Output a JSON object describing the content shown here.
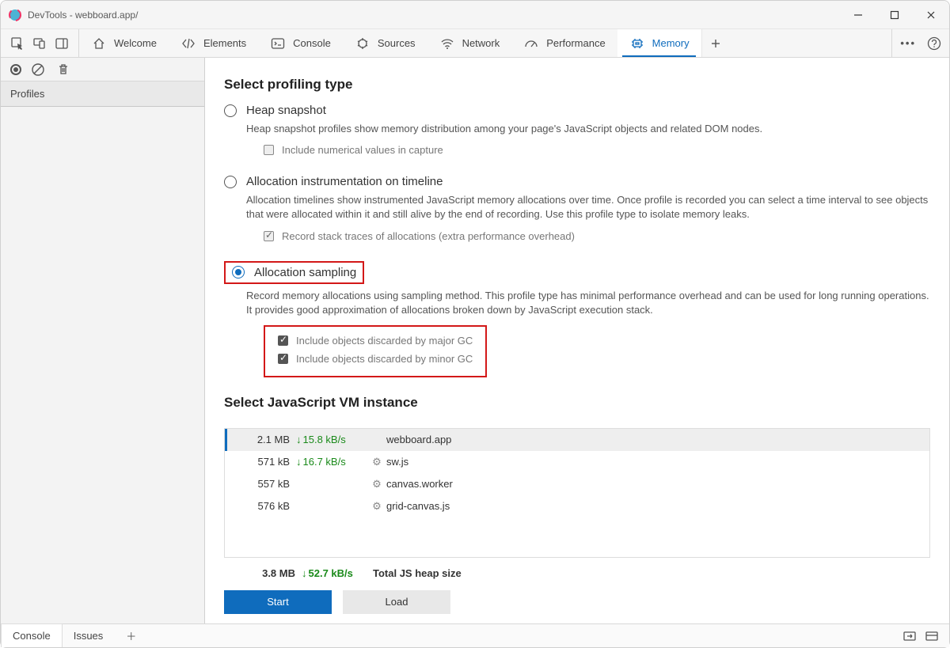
{
  "window": {
    "title": "DevTools - webboard.app/"
  },
  "tabs": [
    {
      "label": "Welcome"
    },
    {
      "label": "Elements"
    },
    {
      "label": "Console"
    },
    {
      "label": "Sources"
    },
    {
      "label": "Network"
    },
    {
      "label": "Performance"
    },
    {
      "label": "Memory"
    }
  ],
  "sidebar": {
    "section": "Profiles"
  },
  "memory": {
    "heading_type": "Select profiling type",
    "heap": {
      "title": "Heap snapshot",
      "desc": "Heap snapshot profiles show memory distribution among your page's JavaScript objects and related DOM nodes.",
      "opt_numeric": "Include numerical values in capture"
    },
    "timeline": {
      "title": "Allocation instrumentation on timeline",
      "desc": "Allocation timelines show instrumented JavaScript memory allocations over time. Once profile is recorded you can select a time interval to see objects that were allocated within it and still alive by the end of recording. Use this profile type to isolate memory leaks.",
      "opt_stack": "Record stack traces of allocations (extra performance overhead)"
    },
    "sampling": {
      "title": "Allocation sampling",
      "desc": "Record memory allocations using sampling method. This profile type has minimal performance overhead and can be used for long running operations. It provides good approximation of allocations broken down by JavaScript execution stack.",
      "opt_major": "Include objects discarded by major GC",
      "opt_minor": "Include objects discarded by minor GC"
    },
    "heading_vm": "Select JavaScript VM instance",
    "instances": [
      {
        "size": "2.1 MB",
        "rate": "15.8 kB/s",
        "name": "webboard.app",
        "gear": false
      },
      {
        "size": "571 kB",
        "rate": "16.7 kB/s",
        "name": "sw.js",
        "gear": true
      },
      {
        "size": "557 kB",
        "rate": "",
        "name": "canvas.worker",
        "gear": true
      },
      {
        "size": "576 kB",
        "rate": "",
        "name": "grid-canvas.js",
        "gear": true
      }
    ],
    "total": {
      "size": "3.8 MB",
      "rate": "52.7 kB/s",
      "label": "Total JS heap size"
    },
    "buttons": {
      "start": "Start",
      "load": "Load"
    }
  },
  "drawer": {
    "console": "Console",
    "issues": "Issues"
  }
}
